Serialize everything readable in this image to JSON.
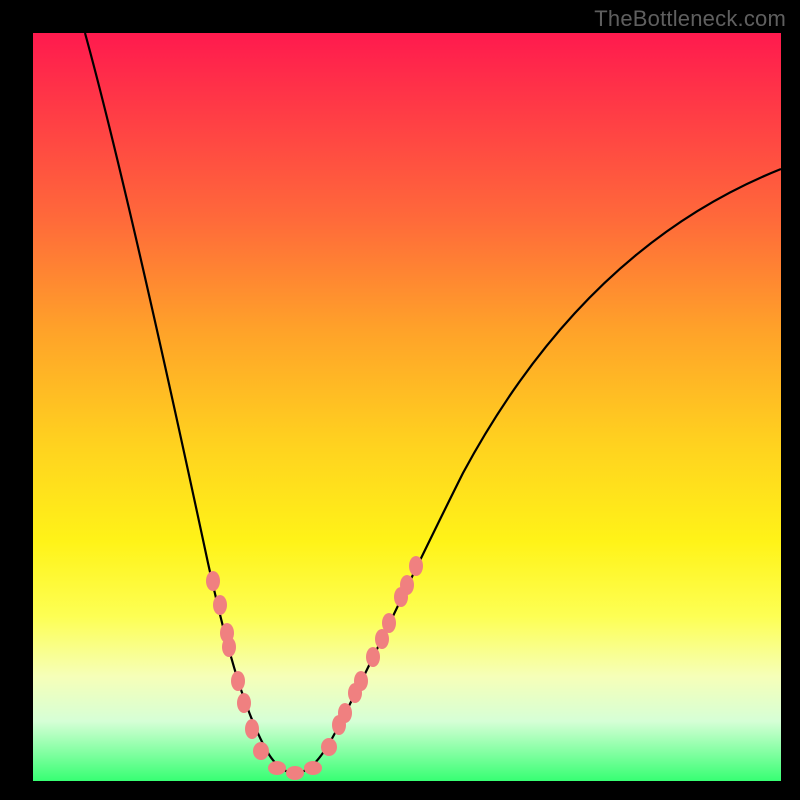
{
  "watermark": "TheBottleneck.com",
  "chart_data": {
    "type": "line",
    "title": "",
    "xlabel": "",
    "ylabel": "",
    "xlim": [
      0,
      100
    ],
    "ylim": [
      0,
      100
    ],
    "grid": false,
    "series": [
      {
        "name": "bottleneck-curve",
        "x": [
          7,
          10,
          14,
          18,
          22,
          25,
          27,
          29,
          31,
          33,
          35,
          38,
          42,
          48,
          55,
          63,
          72,
          82,
          92,
          100
        ],
        "y": [
          100,
          86,
          70,
          55,
          40,
          28,
          20,
          12,
          5,
          2,
          5,
          12,
          22,
          35,
          47,
          57,
          65,
          72,
          78,
          82
        ]
      }
    ],
    "markers": {
      "name": "highlight-dots",
      "color": "#f08080",
      "x_range_left": [
        24,
        31
      ],
      "x_range_right": [
        35,
        46
      ],
      "y_max": 32
    },
    "background_gradient": {
      "top": "#ff1a4e",
      "mid": "#ffd21f",
      "bottom": "#37ff73"
    }
  },
  "colors": {
    "curve": "#000000",
    "marker": "#f08080",
    "frame": "#000000"
  }
}
